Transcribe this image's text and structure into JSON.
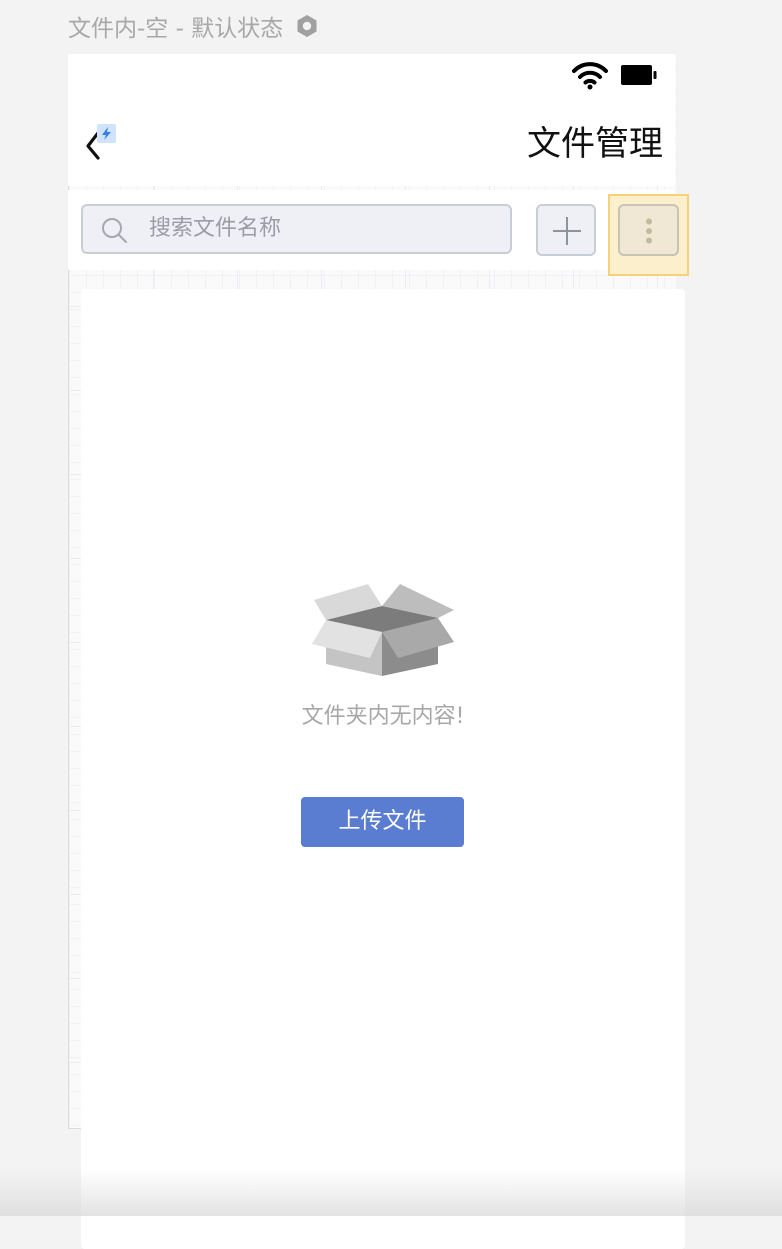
{
  "page": {
    "caption": "文件内-空 - 默认状态",
    "caption_icon": "hexagon-settings-icon"
  },
  "status_bar": {
    "icons": [
      "wifi-icon",
      "battery-icon"
    ]
  },
  "nav": {
    "back_icon": "chevron-left-icon",
    "title": "文件管理"
  },
  "toolbar": {
    "search": {
      "placeholder": "搜索文件名称",
      "icon": "search-icon"
    },
    "add_icon": "plus-icon",
    "more_icon": "vertical-ellipsis-icon"
  },
  "empty_state": {
    "icon": "empty-box-icon",
    "message": "文件夹内无内容!",
    "upload_label": "上传文件"
  },
  "colors": {
    "primary": "#5b7dd1",
    "highlight_fill": "#fcefcc",
    "highlight_border": "#f5d27a",
    "caption_text": "#a8a8a8"
  }
}
